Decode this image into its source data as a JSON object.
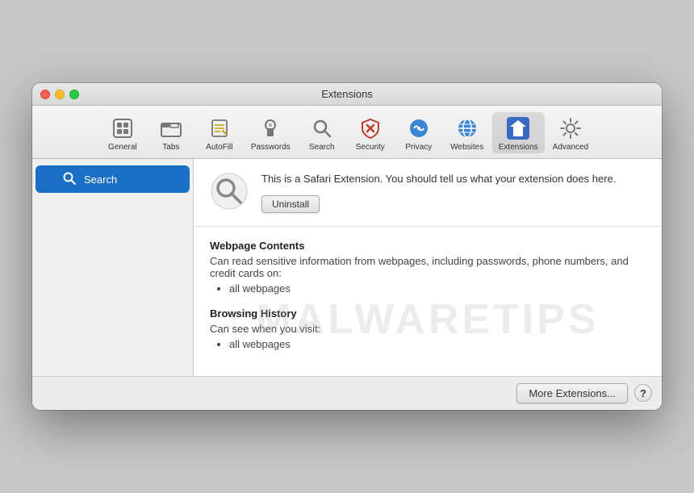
{
  "window": {
    "title": "Extensions"
  },
  "traffic_lights": {
    "close_label": "close",
    "minimize_label": "minimize",
    "maximize_label": "maximize"
  },
  "toolbar": {
    "items": [
      {
        "id": "general",
        "label": "General"
      },
      {
        "id": "tabs",
        "label": "Tabs"
      },
      {
        "id": "autofill",
        "label": "AutoFill"
      },
      {
        "id": "passwords",
        "label": "Passwords"
      },
      {
        "id": "search",
        "label": "Search"
      },
      {
        "id": "security",
        "label": "Security"
      },
      {
        "id": "privacy",
        "label": "Privacy"
      },
      {
        "id": "websites",
        "label": "Websites"
      },
      {
        "id": "extensions",
        "label": "Extensions"
      },
      {
        "id": "advanced",
        "label": "Advanced"
      }
    ]
  },
  "sidebar": {
    "items": [
      {
        "id": "search-ext",
        "label": "Search",
        "enabled": true,
        "selected": true
      }
    ]
  },
  "extension": {
    "description": "This is a Safari Extension. You should tell us what your extension does here.",
    "uninstall_label": "Uninstall"
  },
  "permissions": {
    "sections": [
      {
        "title": "Webpage Contents",
        "description": "Can read sensitive information from webpages, including passwords, phone numbers, and credit cards on:",
        "items": [
          "all webpages"
        ]
      },
      {
        "title": "Browsing History",
        "description": "Can see when you visit:",
        "items": [
          "all webpages"
        ]
      }
    ]
  },
  "bottom_bar": {
    "more_extensions_label": "More Extensions...",
    "help_label": "?"
  },
  "watermark": "MALWARETIPS"
}
